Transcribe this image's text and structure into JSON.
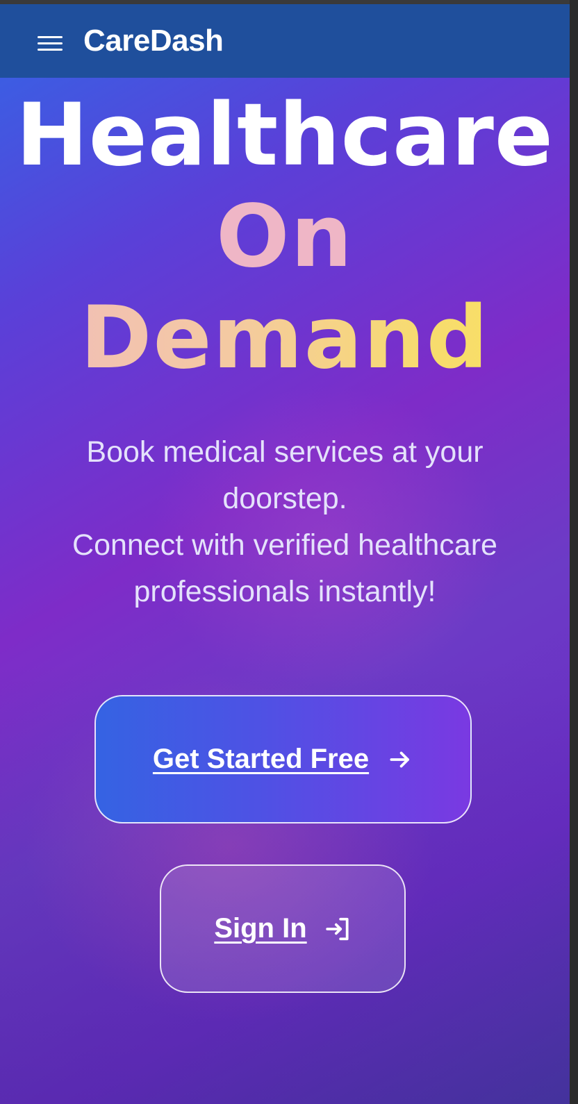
{
  "app": {
    "brand": "CareDash"
  },
  "hero": {
    "title_line1": "Healthcare",
    "title_line2": "On",
    "title_line3": "Demand",
    "subtitle_line1": "Book medical services at your",
    "subtitle_line2": "doorstep.",
    "subtitle_line3": "Connect with verified healthcare",
    "subtitle_line4": "professionals instantly!"
  },
  "actions": {
    "primary_label": "Get Started Free",
    "primary_icon": "arrow-right-icon",
    "secondary_label": "Sign In",
    "secondary_icon": "sign-in-icon"
  },
  "colors": {
    "header": "#1f4f9c",
    "gradient_start": "#3366e6",
    "gradient_mid": "#7e2cc8",
    "accent_pink": "#efb6c6",
    "accent_yellow": "#f9e060",
    "button_primary_start": "#3563e3",
    "button_primary_end": "#7a39e2"
  }
}
